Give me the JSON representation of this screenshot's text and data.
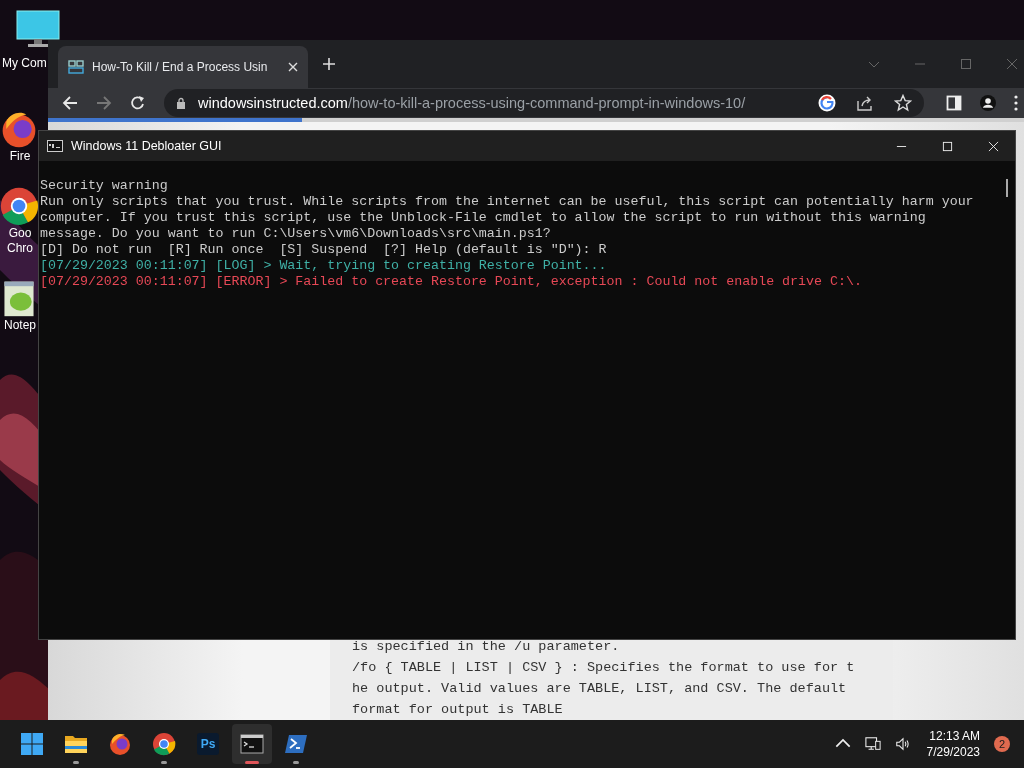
{
  "desktop_icons": [
    {
      "kind": "computer",
      "lines": [
        "My Com"
      ]
    },
    {
      "kind": "firefox",
      "lines": [
        "Fire"
      ]
    },
    {
      "kind": "chrome",
      "lines": [
        "Goo",
        "Chro"
      ]
    },
    {
      "kind": "notepad",
      "lines": [
        "Notep"
      ]
    }
  ],
  "browser": {
    "tab": {
      "title": "How-To Kill / End a Process Usin"
    },
    "url": {
      "domain": "windowsinstructed.com",
      "path": "/how-to-kill-a-process-using-command-prompt-in-windows-10/"
    },
    "loading": {
      "level": 0.26
    },
    "page_lines": [
      "is specified in the /u parameter.",
      "/fo { TABLE | LIST | CSV } : Specifies the format to use for t",
      "he output. Valid values are TABLE, LIST, and CSV. The default",
      "format for output is TABLE"
    ]
  },
  "console": {
    "title": "Windows 11 Debloater GUI",
    "lines": [
      {
        "kind": "plain",
        "text": "Security warning"
      },
      {
        "kind": "plain",
        "text": "Run only scripts that you trust. While scripts from the internet can be useful, this script can potentially harm your"
      },
      {
        "kind": "plain",
        "text": "computer. If you trust this script, use the Unblock-File cmdlet to allow the script to run without this warning"
      },
      {
        "kind": "plain",
        "text": "message. Do you want to run C:\\Users\\vm6\\Downloads\\src\\main.ps1?"
      },
      {
        "kind": "plain",
        "text": "[D] Do not run  [R] Run once  [S] Suspend  [?] Help (default is \"D\"): R"
      },
      {
        "kind": "log",
        "text": "[07/29/2023 00:11:07] [LOG] > Wait, trying to creating Restore Point..."
      },
      {
        "kind": "error",
        "text": "[07/29/2023 00:11:07] [ERROR] > Failed to create Restore Point, exception : Could not enable drive C:\\."
      }
    ]
  },
  "taskbar": {
    "apps": [
      {
        "kind": "start",
        "running": false,
        "selected": false
      },
      {
        "kind": "explorer",
        "running": true,
        "selected": false
      },
      {
        "kind": "firefox",
        "running": false,
        "selected": false
      },
      {
        "kind": "chrome",
        "running": true,
        "selected": false
      },
      {
        "kind": "photoshop",
        "label": "Ps",
        "running": false,
        "selected": false
      },
      {
        "kind": "terminal",
        "running": true,
        "selected": true
      },
      {
        "kind": "powershell",
        "running": true,
        "selected": false
      }
    ],
    "time": "12:13 AM",
    "date": "7/29/2023",
    "notifications": "2"
  }
}
